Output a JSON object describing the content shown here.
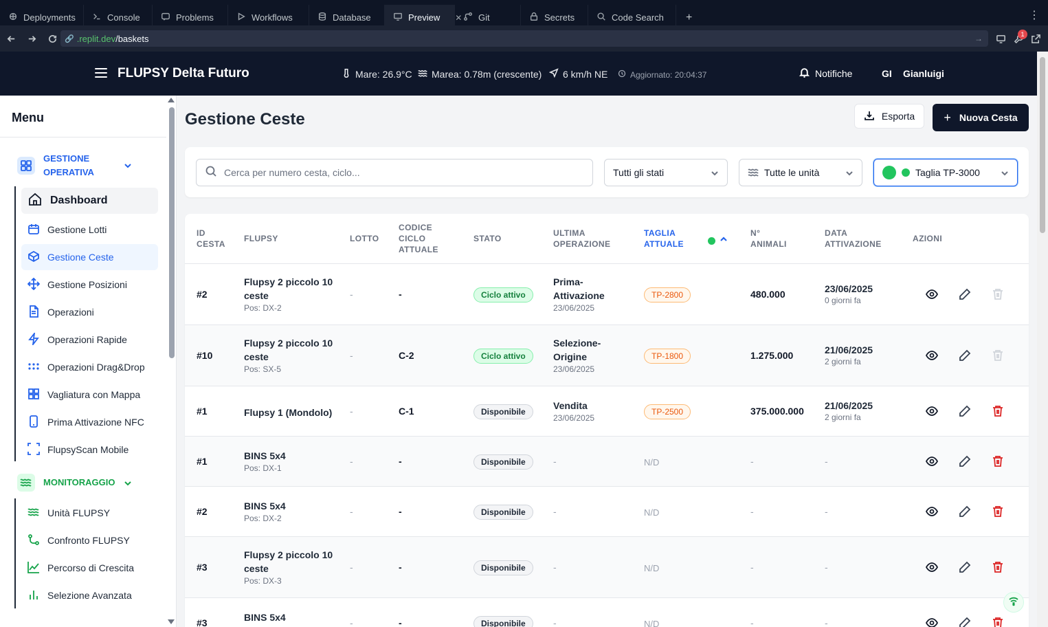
{
  "ide": {
    "tabs": [
      {
        "label": "Deployments",
        "icon": "deployments-icon"
      },
      {
        "label": "Console",
        "icon": "console-icon"
      },
      {
        "label": "Problems",
        "icon": "problems-icon"
      },
      {
        "label": "Workflows",
        "icon": "workflows-icon"
      },
      {
        "label": "Database",
        "icon": "database-icon"
      },
      {
        "label": "Preview",
        "icon": "preview-icon",
        "active": true
      },
      {
        "label": "Git",
        "icon": "git-icon"
      },
      {
        "label": "Secrets",
        "icon": "lock-icon"
      },
      {
        "label": "Code Search",
        "icon": "search-icon"
      }
    ],
    "plus": "+",
    "more": "⋮"
  },
  "browser": {
    "url_prefix": ".replit.dev",
    "url_path": "/baskets",
    "badge_count": "1"
  },
  "header": {
    "title": "FLUPSY Delta Futuro",
    "sea_temp": "Mare: 26.9°C",
    "tide": "Marea: 0.78m (crescente)",
    "wind": "6 km/h NE",
    "updated": "Aggiornato: 20:04:37",
    "notifications": "Notifiche",
    "user_initials": "GI",
    "user_name": "Gianluigi"
  },
  "sidebar": {
    "title": "Menu",
    "group1": {
      "label_line1": "GESTIONE",
      "label_line2": "OPERATIVA",
      "color": "#2563eb"
    },
    "group1_items": [
      {
        "label": "Dashboard",
        "icon": "home-icon"
      },
      {
        "label": "Gestione Lotti",
        "icon": "calendar-icon"
      },
      {
        "label": "Gestione Ceste",
        "icon": "box-icon"
      },
      {
        "label": "Gestione Posizioni",
        "icon": "move-icon"
      },
      {
        "label": "Operazioni",
        "icon": "file-icon"
      },
      {
        "label": "Operazioni Rapide",
        "icon": "lightning-icon"
      },
      {
        "label": "Operazioni Drag&Drop",
        "icon": "dots-grid-icon"
      },
      {
        "label": "Vagliatura con Mappa",
        "icon": "grid-icon"
      },
      {
        "label": "Prima Attivazione NFC",
        "icon": "smartphone-icon"
      },
      {
        "label": "FlupsyScan Mobile",
        "icon": "scan-icon"
      }
    ],
    "group2": {
      "label": "MONITORAGGIO",
      "color": "#16a34a"
    },
    "group2_items": [
      {
        "label": "Unità FLUPSY",
        "icon": "waves-icon"
      },
      {
        "label": "Confronto FLUPSY",
        "icon": "compare-icon"
      },
      {
        "label": "Percorso di Crescita",
        "icon": "line-chart-icon"
      },
      {
        "label": "Selezione Avanzata",
        "icon": "bar-chart-icon"
      }
    ]
  },
  "main": {
    "title": "Gestione Ceste",
    "export_label": "Esporta",
    "new_label": "Nuova Cesta",
    "search_placeholder": "Cerca per numero cesta, ciclo...",
    "filter_state": "Tutti gli stati",
    "filter_unit": "Tutte le unità",
    "filter_size": "Taglia TP-3000"
  },
  "table": {
    "headers": {
      "id": [
        "ID",
        "CESTA"
      ],
      "flupsy": "FLUPSY",
      "lotto": "LOTTO",
      "codice": [
        "CODICE",
        "CICLO",
        "ATTUALE"
      ],
      "stato": "STATO",
      "ultima": [
        "ULTIMA",
        "OPERAZIONE"
      ],
      "taglia": [
        "TAGLIA",
        "ATTUALE"
      ],
      "animali": [
        "N°",
        "ANIMALI"
      ],
      "data": [
        "DATA",
        "ATTIVAZIONE"
      ],
      "azioni": "AZIONI"
    },
    "rows": [
      {
        "id": "#2",
        "flupsy": "Flupsy 2 piccolo 10 ceste",
        "pos": "Pos: DX-2",
        "lotto": "-",
        "codice": "-",
        "stato": "Ciclo attivo",
        "op": "Prima-Attivazione",
        "op_date": "23/06/2025",
        "taglia": "TP-2800",
        "animali": "480.000",
        "data": "23/06/2025",
        "rel": "0 giorni fa"
      },
      {
        "id": "#10",
        "flupsy": "Flupsy 2 piccolo 10 ceste",
        "pos": "Pos: SX-5",
        "lotto": "-",
        "codice": "C-2",
        "stato": "Ciclo attivo",
        "op": "Selezione-Origine",
        "op_date": "23/06/2025",
        "taglia": "TP-1800",
        "animali": "1.275.000",
        "data": "21/06/2025",
        "rel": "2 giorni fa"
      },
      {
        "id": "#1",
        "flupsy": "Flupsy 1 (Mondolo)",
        "pos": "",
        "lotto": "-",
        "codice": "C-1",
        "stato": "Disponibile",
        "op": "Vendita",
        "op_date": "23/06/2025",
        "taglia": "TP-2500",
        "animali": "375.000.000",
        "data": "21/06/2025",
        "rel": "2 giorni fa"
      },
      {
        "id": "#1",
        "flupsy": "BINS 5x4",
        "pos": "Pos: DX-1",
        "lotto": "-",
        "codice": "-",
        "stato": "Disponibile",
        "op": "-",
        "op_date": "",
        "taglia": "N/D",
        "animali": "-",
        "data": "-",
        "rel": ""
      },
      {
        "id": "#2",
        "flupsy": "BINS 5x4",
        "pos": "Pos: DX-2",
        "lotto": "-",
        "codice": "-",
        "stato": "Disponibile",
        "op": "-",
        "op_date": "",
        "taglia": "N/D",
        "animali": "-",
        "data": "-",
        "rel": ""
      },
      {
        "id": "#3",
        "flupsy": "Flupsy 2 piccolo 10 ceste",
        "pos": "Pos: DX-3",
        "lotto": "-",
        "codice": "-",
        "stato": "Disponibile",
        "op": "-",
        "op_date": "",
        "taglia": "N/D",
        "animali": "-",
        "data": "-",
        "rel": ""
      },
      {
        "id": "#3",
        "flupsy": "BINS 5x4",
        "pos": "",
        "lotto": "-",
        "codice": "-",
        "stato": "Disponibile",
        "op": "-",
        "op_date": "",
        "taglia": "N/D",
        "animali": "-",
        "data": "-",
        "rel": ""
      }
    ]
  }
}
